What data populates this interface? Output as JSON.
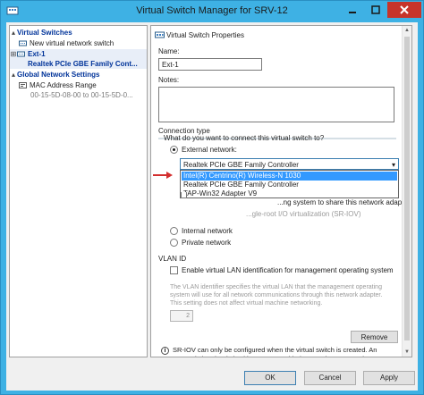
{
  "window": {
    "title": "Virtual Switch Manager for SRV-12"
  },
  "tree": {
    "virtual_switches_header": "Virtual Switches",
    "new_switch": "New virtual network switch",
    "switch_name": "Ext-1",
    "switch_adapter": "Realtek PCIe GBE Family Cont...",
    "global_header": "Global Network Settings",
    "mac_title": "MAC Address Range",
    "mac_value": "00-15-5D-08-00 to 00-15-5D-0..."
  },
  "properties": {
    "heading": "Virtual Switch Properties",
    "name_label": "Name:",
    "name_value": "Ext-1",
    "notes_label": "Notes:",
    "connection_type_label": "Connection type",
    "connection_question": "What do you want to connect this virtual switch to?",
    "external_label": "External network:",
    "external_selected": "Realtek PCIe GBE Family Controller",
    "adapter_options": [
      "Intel(R) Centrino(R) Wireless-N 1030",
      "Realtek PCIe GBE Family Controller",
      "TAP-Win32 Adapter V9"
    ],
    "hidden_option_tail": "...ng system to share this network adapter",
    "sriov_partial": "...gle-root I/O virtualization (SR-IOV)",
    "internal_label": "Internal network",
    "private_label": "Private network",
    "vlan_heading": "VLAN ID",
    "vlan_checkbox": "Enable virtual LAN identification for management operating system",
    "vlan_description": "The VLAN identifier specifies the virtual LAN that the management operating system will use for all network communications through this network adapter. This setting does not affect virtual machine networking.",
    "vlan_value": "2",
    "remove_button": "Remove",
    "sriov_note": "SR-IOV can only be configured when the virtual switch is created. An external virtual switch with SR-IOV enabled cannot be converted to an internal or private switch."
  },
  "buttons": {
    "ok": "OK",
    "cancel": "Cancel",
    "apply": "Apply"
  },
  "colors": {
    "title_bar": "#3eb1e4",
    "close_button": "#c7342a",
    "highlight": "#3399ff",
    "annotation_arrow": "#d32f2f"
  }
}
